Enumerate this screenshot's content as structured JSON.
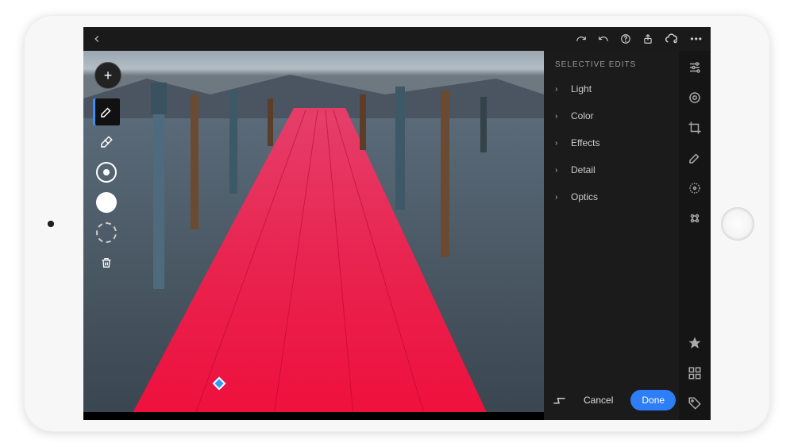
{
  "topbar": {
    "back_icon": "chevron-left"
  },
  "toolbar": {
    "add_label": "+"
  },
  "tools": {
    "brush": "brush",
    "eraser": "eraser",
    "circle_target": "feather",
    "circle_solid": "mask-solid",
    "circle_outline": "mask-outline",
    "trash": "delete"
  },
  "panel": {
    "title": "SELECTIVE EDITS",
    "sections": [
      {
        "label": "Light"
      },
      {
        "label": "Color"
      },
      {
        "label": "Effects"
      },
      {
        "label": "Detail"
      },
      {
        "label": "Optics"
      }
    ],
    "cancel_label": "Cancel",
    "done_label": "Done"
  },
  "rail": {
    "adjust": "adjust",
    "presets": "presets",
    "crop": "crop",
    "brush": "brush",
    "radial": "radial",
    "selective": "selective",
    "star": "star",
    "grid": "grid",
    "tag": "tag"
  },
  "colors": {
    "accent": "#2d7ef7"
  }
}
